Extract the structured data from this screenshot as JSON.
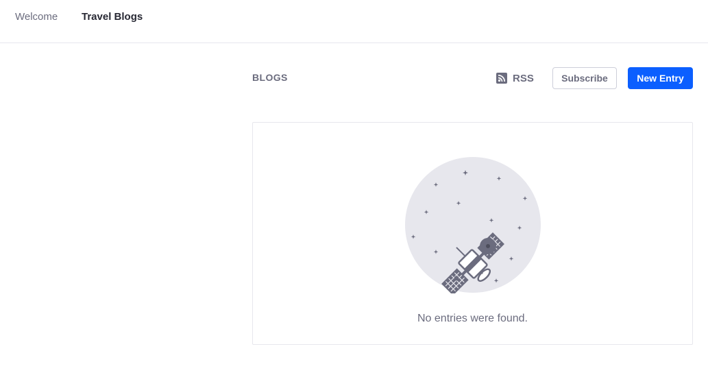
{
  "nav": {
    "items": [
      {
        "label": "Welcome",
        "active": false
      },
      {
        "label": "Travel Blogs",
        "active": true
      }
    ]
  },
  "blogs": {
    "heading": "BLOGS",
    "rss_label": "RSS",
    "subscribe_label": "Subscribe",
    "new_entry_label": "New Entry",
    "empty_message": "No entries were found."
  },
  "colors": {
    "primary": "#0b5fff",
    "text_muted": "#6b6c7e",
    "text_dark": "#272833",
    "border": "#e7e7ed",
    "illustration_bg": "#e7e7ed",
    "illustration_fg": "#6b6c7e"
  },
  "icons": {
    "rss": "rss-icon",
    "empty_state": "satellite-illustration"
  }
}
